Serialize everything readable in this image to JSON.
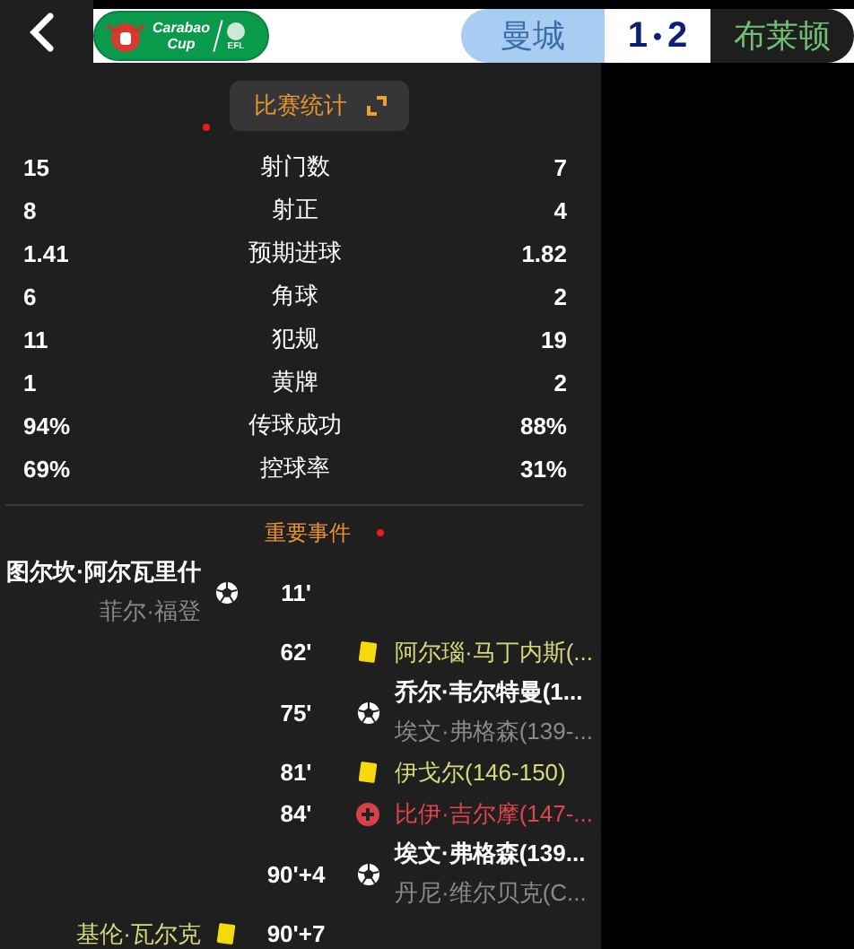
{
  "header": {
    "competition_logo": {
      "line_1": "Carabao",
      "line_2": "Cup",
      "badge": "EFL"
    },
    "home_team": "曼城",
    "score": "1",
    "score_separator": "•",
    "away_score": "2",
    "away_team": "布莱顿"
  },
  "stats_button": {
    "label": "比赛统计"
  },
  "stats": [
    {
      "home": "15",
      "label": "射门数",
      "away": "7"
    },
    {
      "home": "8",
      "label": "射正",
      "away": "4"
    },
    {
      "home": "1.41",
      "label": "预期进球",
      "away": "1.82"
    },
    {
      "home": "6",
      "label": "角球",
      "away": "2"
    },
    {
      "home": "11",
      "label": "犯规",
      "away": "19"
    },
    {
      "home": "1",
      "label": "黄牌",
      "away": "2"
    },
    {
      "home": "94%",
      "label": "传球成功",
      "away": "88%"
    },
    {
      "home": "69%",
      "label": "控球率",
      "away": "31%"
    }
  ],
  "events_title": "重要事件",
  "events": [
    {
      "home": true,
      "minute": "11'",
      "kind": "goal",
      "player": "图尔坎·阿尔瓦里什",
      "assist": "菲尔·福登"
    },
    {
      "home": false,
      "minute": "62'",
      "kind": "yellow",
      "player": "阿尔瑙·马丁内斯(..."
    },
    {
      "home": false,
      "minute": "75'",
      "kind": "goal",
      "player": "乔尔·韦尔特曼(1...",
      "assist": "埃文·弗格森(139-..."
    },
    {
      "home": false,
      "minute": "81'",
      "kind": "yellow",
      "player": "伊戈尔(146-150)"
    },
    {
      "home": false,
      "minute": "84'",
      "kind": "red",
      "player": "比伊·吉尔摩(147-..."
    },
    {
      "home": false,
      "minute": "90'+4",
      "kind": "goal",
      "player": "埃文·弗格森(139...",
      "assist": "丹尼·维尔贝克(C..."
    },
    {
      "home": true,
      "minute": "90'+7",
      "kind": "yellow",
      "player": "基伦·瓦尔克"
    }
  ]
}
